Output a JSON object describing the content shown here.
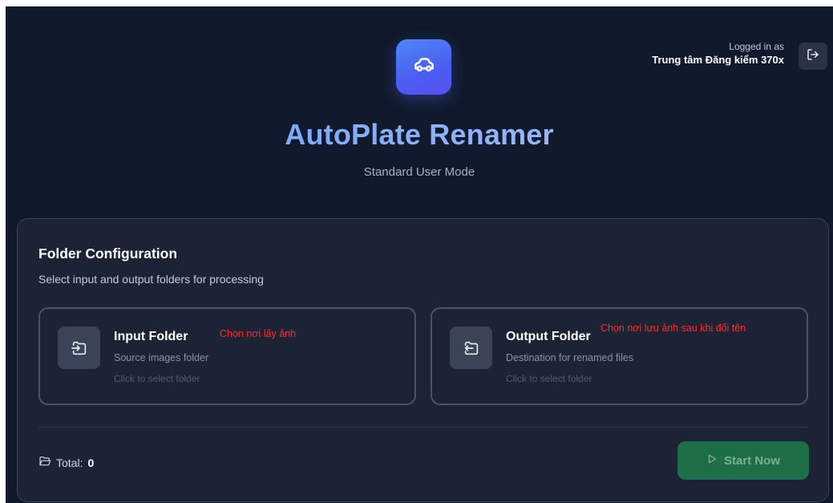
{
  "header": {
    "logged_in_label": "Logged in as",
    "user_name": "Trung tâm Đăng kiểm 370x",
    "logout_icon": "logout-icon"
  },
  "hero": {
    "logo_icon": "car-icon",
    "title": "AutoPlate Renamer",
    "subtitle": "Standard User Mode"
  },
  "config": {
    "title": "Folder Configuration",
    "description": "Select input and output folders for processing",
    "input_folder": {
      "icon": "folder-input-icon",
      "title": "Input Folder",
      "subtitle": "Source images folder",
      "hint": "Click to select folder",
      "annotation": "Chọn nơi lấy ảnh"
    },
    "output_folder": {
      "icon": "folder-output-icon",
      "title": "Output Folder",
      "subtitle": "Destination for renamed files",
      "hint": "Click to select folder",
      "annotation": "Chọn nơi lưu ảnh sau khi đổi tên"
    },
    "total_label": "Total:",
    "total_value": "0",
    "start_label": "Start Now"
  },
  "colors": {
    "background": "#111a2c",
    "card": "#1b2335",
    "accent_blue": "#4b5ef2",
    "start_button": "#1c6f47",
    "annotation": "#ff2d2d"
  }
}
